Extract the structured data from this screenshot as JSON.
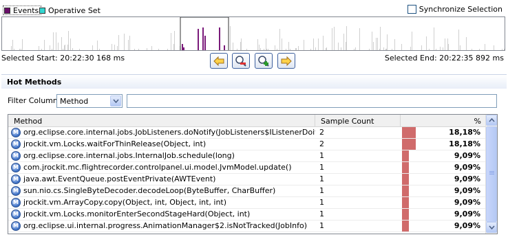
{
  "legend": {
    "events_label": "Events",
    "events_color": "#6a0f6a",
    "opset_label": "Operative Set",
    "opset_color": "#33d6d0"
  },
  "sync": {
    "label": "Synchronize Selection",
    "checked": false
  },
  "timeline": {
    "base_color": "#cfcfcf",
    "event_color": "#7a1a7a",
    "selection_box": true
  },
  "selection": {
    "start_label": "Selected Start: 20:22:30 168 ms",
    "end_label": "Selected End: 20:22:35 892 ms"
  },
  "toolbar": {
    "back_icon": "arrow-left-icon",
    "zoom_out_icon": "zoom-out-icon",
    "zoom_in_icon": "zoom-in-icon",
    "forward_icon": "arrow-right-icon"
  },
  "hot_methods": {
    "title": "Hot Methods",
    "filter_label": "Filter Column",
    "filter_selected": "Method",
    "filter_text": "",
    "columns": {
      "method": "Method",
      "count": "Sample Count",
      "pct": "%"
    },
    "rows": [
      {
        "method": "org.eclipse.core.internal.jobs.JobListeners.doNotify(JobListeners$IListenerDoit, IJob...",
        "count": "2",
        "pct": "18,18%",
        "fraction": 0.1818
      },
      {
        "method": "jrockit.vm.Locks.waitForThinRelease(Object, int)",
        "count": "2",
        "pct": "18,18%",
        "fraction": 0.1818
      },
      {
        "method": "org.eclipse.core.internal.jobs.InternalJob.schedule(long)",
        "count": "1",
        "pct": "9,09%",
        "fraction": 0.0909
      },
      {
        "method": "com.jrockit.mc.flightrecorder.controlpanel.ui.model.JvmModel.update()",
        "count": "1",
        "pct": "9,09%",
        "fraction": 0.0909
      },
      {
        "method": "java.awt.EventQueue.postEventPrivate(AWTEvent)",
        "count": "1",
        "pct": "9,09%",
        "fraction": 0.0909
      },
      {
        "method": "sun.nio.cs.SingleByteDecoder.decodeLoop(ByteBuffer, CharBuffer)",
        "count": "1",
        "pct": "9,09%",
        "fraction": 0.0909
      },
      {
        "method": "jrockit.vm.ArrayCopy.copy(Object, int, Object, int, int)",
        "count": "1",
        "pct": "9,09%",
        "fraction": 0.0909
      },
      {
        "method": "jrockit.vm.Locks.monitorEnterSecondStageHard(Object, int)",
        "count": "1",
        "pct": "9,09%",
        "fraction": 0.0909
      },
      {
        "method": "org.eclipse.ui.internal.progress.AnimationManager$2.isNotTracked(JobInfo)",
        "count": "1",
        "pct": "9,09%",
        "fraction": 0.0909
      }
    ]
  }
}
